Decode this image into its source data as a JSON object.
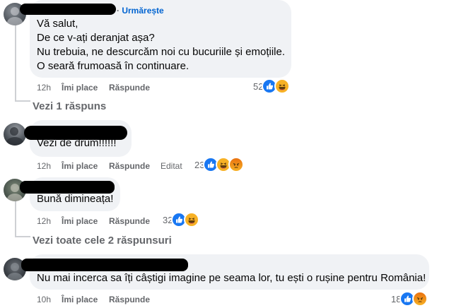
{
  "comments": [
    {
      "follow_separator": "·",
      "follow_label": "Urmărește",
      "lines": [
        "Vă salut,",
        "De ce v-ați deranjat așa?",
        "Nu trebuia, ne descurcăm noi cu bucuriile și emoțiile.",
        "O seară frumoasă în continuare."
      ],
      "time": "12h",
      "like_label": "Îmi place",
      "reply_label": "Răspunde",
      "edited_label": "",
      "reaction_count": "52",
      "reactions": [
        "like-icon",
        "haha-icon"
      ]
    },
    {
      "lines": [
        "Vezi de drum!!!!!!"
      ],
      "time": "12h",
      "like_label": "Îmi place",
      "reply_label": "Răspunde",
      "edited_label": "Editat",
      "reaction_count": "23",
      "reactions": [
        "like-icon",
        "haha-icon",
        "angry-icon"
      ]
    },
    {
      "lines": [
        "Bună dimineața!"
      ],
      "time": "12h",
      "like_label": "Îmi place",
      "reply_label": "Răspunde",
      "edited_label": "",
      "reaction_count": "32",
      "reactions": [
        "like-icon",
        "haha-icon"
      ]
    },
    {
      "lines": [
        "Nu mai incerca sa îți câștigi imagine pe seama lor, tu ești o rușine pentru România!"
      ],
      "time": "10h",
      "like_label": "Îmi place",
      "reply_label": "Răspunde",
      "edited_label": "",
      "reaction_count": "18",
      "reactions": [
        "like-icon",
        "angry-icon"
      ]
    }
  ],
  "view_replies": [
    "Vezi 1 răspuns",
    "Vezi toate cele 2 răspunsuri"
  ],
  "colors": {
    "bubble": "#f0f2f5",
    "link_blue": "#0064d1",
    "meta_gray": "#65676b",
    "like_blue": "#1877f2",
    "haha_yellow": "#f7b125"
  }
}
